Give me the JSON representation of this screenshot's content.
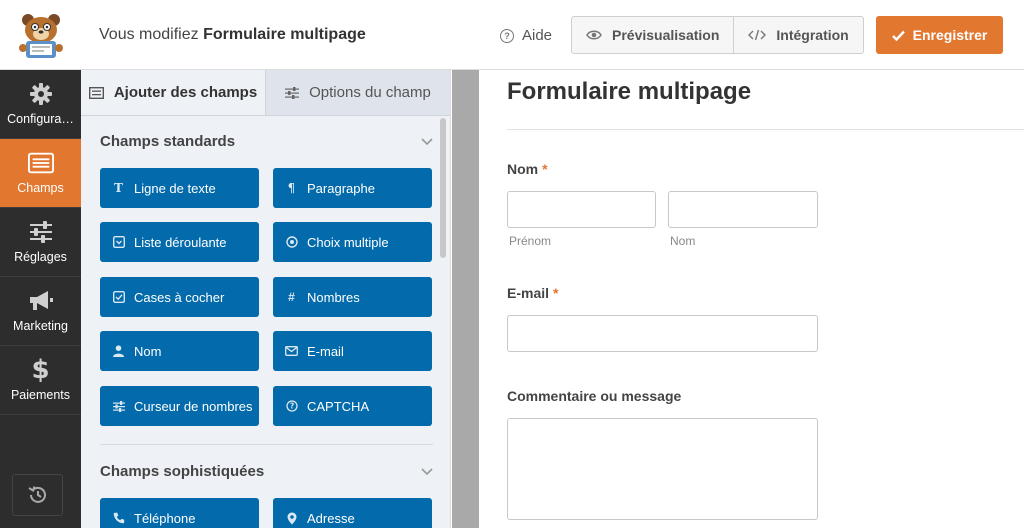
{
  "header": {
    "editing_prefix": "Vous modifiez",
    "form_name": "Formulaire multipage",
    "help_label": "Aide",
    "preview_label": "Prévisualisation",
    "embed_label": "Intégration",
    "save_label": "Enregistrer"
  },
  "nav": {
    "items": [
      {
        "label": "Configura…",
        "icon": "gear-icon"
      },
      {
        "label": "Champs",
        "icon": "fields-icon",
        "active": true
      },
      {
        "label": "Réglages",
        "icon": "sliders-icon"
      },
      {
        "label": "Marketing",
        "icon": "megaphone-icon"
      },
      {
        "label": "Paiements",
        "icon": "dollar-icon"
      }
    ]
  },
  "panel": {
    "tabs": [
      {
        "label": "Ajouter des champs",
        "active": true
      },
      {
        "label": "Options du champ"
      }
    ],
    "standard_title": "Champs standards",
    "standard_fields": [
      {
        "label": "Ligne de texte",
        "icon": "text-line-icon"
      },
      {
        "label": "Paragraphe",
        "icon": "paragraph-icon"
      },
      {
        "label": "Liste déroulante",
        "icon": "dropdown-icon"
      },
      {
        "label": "Choix multiple",
        "icon": "radio-icon"
      },
      {
        "label": "Cases à cocher",
        "icon": "checkbox-icon"
      },
      {
        "label": "Nombres",
        "icon": "hash-icon"
      },
      {
        "label": "Nom",
        "icon": "user-icon"
      },
      {
        "label": "E-mail",
        "icon": "envelope-icon"
      },
      {
        "label": "Curseur de nombres",
        "icon": "sliders-icon"
      },
      {
        "label": "CAPTCHA",
        "icon": "question-icon"
      }
    ],
    "fancy_title": "Champs sophistiquées",
    "fancy_fields": [
      {
        "label": "Téléphone",
        "icon": "phone-icon"
      },
      {
        "label": "Adresse",
        "icon": "map-pin-icon"
      }
    ]
  },
  "preview": {
    "title": "Formulaire multipage",
    "name_label": "Nom",
    "required_mark": "*",
    "first_sublabel": "Prénom",
    "last_sublabel": "Nom",
    "email_label": "E-mail",
    "comment_label": "Commentaire ou message"
  },
  "colors": {
    "accent": "#e27730",
    "field_button": "#036aab",
    "nav_bg": "#2d2d2d"
  }
}
